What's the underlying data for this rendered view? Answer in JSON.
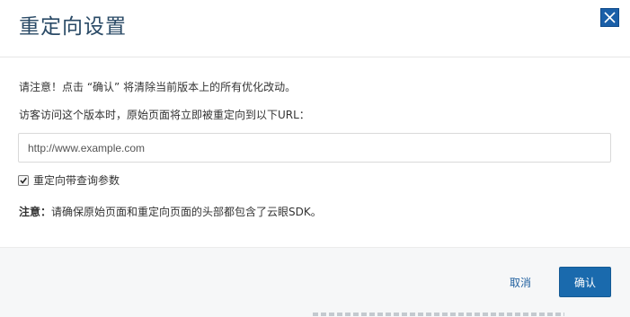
{
  "dialog": {
    "title": "重定向设置",
    "close_icon": "close-x-icon",
    "notice": "请注意！点击 “确认” 将清除当前版本上的所有优化改动。",
    "redirect_label": "访客访问这个版本时，原始页面将立即被重定向到以下URL：",
    "url_input": {
      "value": "",
      "placeholder": "http://www.example.com"
    },
    "keep_query": {
      "checked": true,
      "label": "重定向带查询参数"
    },
    "note": {
      "prefix": "注意：",
      "text": "请确保原始页面和重定向页面的头部都包含了云眼SDK。"
    },
    "buttons": {
      "cancel": "取消",
      "confirm": "确认"
    }
  },
  "colors": {
    "title": "#2a4a66",
    "primary": "#1a6aad",
    "close_bg": "#1a5fa8",
    "link": "#1f5f9e",
    "footer_bg": "#f6f7f8"
  }
}
